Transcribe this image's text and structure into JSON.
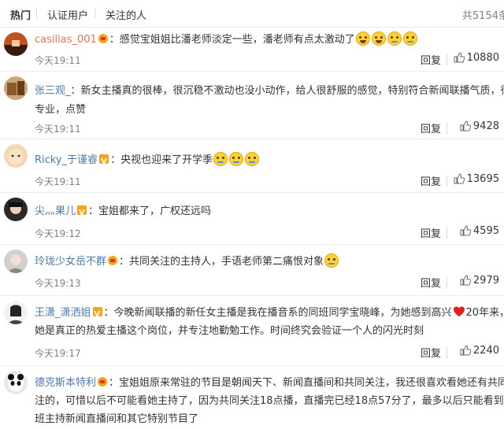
{
  "tabs": [
    "热门",
    "认证用户",
    "关注的人"
  ],
  "total": "共5154条",
  "reply_label": "回复",
  "colors": {
    "username": "#eb7350",
    "username_blue": "#4a7bb0",
    "badge": "#f7a21b",
    "muted": "#808080"
  },
  "comments": [
    {
      "user": "casillas_001",
      "badge": "crown-icon",
      "text": "：感觉宝姐姐比潘老师淡定一些，潘老师有点太激动了",
      "lines": [],
      "time": "今天19:11",
      "likes": "10880"
    },
    {
      "user": "张三观_",
      "badge": "",
      "text": "：新女主播真的很棒，很沉稳不激动也没小动作，给人很舒服的感觉，特别符合新闻联播气质，很",
      "lines": [
        "专业，点赞"
      ],
      "time": "今天19:11",
      "likes": "9428"
    },
    {
      "user": "Ricky_于谨睿",
      "badge": "v-icon",
      "text": "：央视也迎来了开学季",
      "lines": [],
      "time": "今天19:11",
      "likes": "13695"
    },
    {
      "user": "尖灬果儿",
      "badge": "v-icon",
      "text": "：宝姐都来了，广权还远吗",
      "lines": [],
      "time": "今天19:12",
      "likes": "4595"
    },
    {
      "user": "玲珑少女岳不群",
      "badge": "crown-icon",
      "text": "：共同关注的主持人，手语老师第二痛恨对象",
      "lines": [],
      "time": "今天19:13",
      "likes": "2979"
    },
    {
      "user": "王潇_潇洒姐",
      "badge": "v-icon",
      "text": "：今晚新闻联播的新任女主播是我在播音系的同班同学宝晓峰，为她感到高兴",
      "text2": "20年来，",
      "lines": [
        "她是真正的热爱主播这个岗位，并专注地勤勉工作。时间终究会验证一个人的闪光时刻"
      ],
      "time": "今天19:17",
      "likes": "2240"
    },
    {
      "user": "德克斯本特利",
      "badge": "crown-icon",
      "text": "：宝姐姐原来常驻的节目是朝闻天下、新闻直播间和共同关注，我还很喜欢看她还有共同关",
      "lines": [
        "注的，可惜以后不可能看她主持了，因为共同关注18点播，直播完已经18点57分了，最多以后只能看到她代",
        "班主持新闻直播间和其它特别节目了"
      ],
      "time": "",
      "likes": ""
    }
  ]
}
